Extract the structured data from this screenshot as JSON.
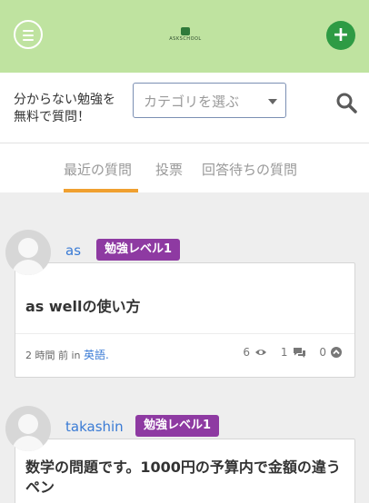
{
  "header": {
    "logo_text": "ASKSCHOOL",
    "colors": {
      "header_bg": "#bfe3a0",
      "add_button": "#2e9b44"
    }
  },
  "search": {
    "tagline": "分からない勉強を無料で質問！",
    "category_placeholder": "カテゴリを選ぶ"
  },
  "tabs": [
    {
      "label": "最近の質問",
      "active": true
    },
    {
      "label": "投票",
      "active": false
    },
    {
      "label": "回答待ちの質問",
      "active": false
    }
  ],
  "posts": [
    {
      "user": "as",
      "badge": "勉強レベル1",
      "title": "as wellの使い方",
      "time": "2 時間 前",
      "in_word": "in",
      "category": "英語.",
      "views": "6",
      "answers": "1",
      "votes": "0"
    },
    {
      "user": "takashin",
      "badge": "勉強レベル1",
      "title": "数学の問題です。1000円の予算内で金額の違うペン"
    }
  ],
  "icons": [
    "menu-icon",
    "plus-icon",
    "search-icon",
    "chevron-down-icon",
    "eye-icon",
    "comments-icon",
    "upvote-icon"
  ]
}
